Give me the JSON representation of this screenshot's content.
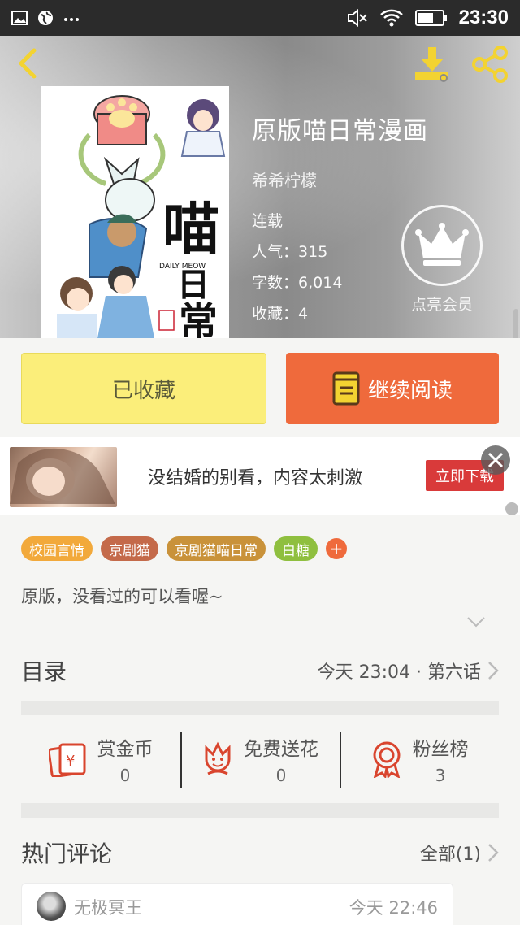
{
  "status_bar": {
    "time": "23:30",
    "icons": [
      "image-icon",
      "globe-icon",
      "more-dots-icon",
      "mute-icon",
      "wifi-icon",
      "battery-icon"
    ]
  },
  "header": {
    "back_icon": "back-chevron-icon",
    "download_icon": "download-icon",
    "share_icon": "share-icon"
  },
  "comic": {
    "title": "原版喵日常漫画",
    "author": "希希柠檬",
    "status": "连载",
    "popularity_label": "人气：",
    "popularity": "315",
    "word_count_label": "字数：",
    "word_count": "6,014",
    "favorites_label": "收藏：",
    "favorites": "4",
    "vip_label": "点亮会员",
    "cover_caption": "DAILY MEOW"
  },
  "actions": {
    "favorited_label": "已收藏",
    "continue_label": "继续阅读"
  },
  "ad": {
    "text": "没结婚的别看，内容太刺激",
    "button": "立即下载"
  },
  "tags": [
    {
      "label": "校园言情",
      "color": "#f2a93b"
    },
    {
      "label": "京剧猫",
      "color": "#c46a4a"
    },
    {
      "label": "京剧猫喵日常",
      "color": "#c9923a"
    },
    {
      "label": "白糖",
      "color": "#8fbf3f"
    }
  ],
  "tag_add": "+",
  "description": "原版，没看过的可以看喔~",
  "catalog": {
    "title": "目录",
    "latest": "今天 23:04 · 第六话"
  },
  "rewards": [
    {
      "label": "赏金币",
      "value": "0",
      "icon": "red-envelope-icon"
    },
    {
      "label": "免费送花",
      "value": "0",
      "icon": "flower-icon"
    },
    {
      "label": "粉丝榜",
      "value": "3",
      "icon": "medal-icon"
    }
  ],
  "comments": {
    "title": "热门评论",
    "all_label": "全部(1)",
    "items": [
      {
        "user": "无极冥王",
        "time": "今天 22:46"
      }
    ]
  },
  "colors": {
    "accent_orange": "#ef6a3c",
    "favorite_yellow": "#fbee7a",
    "icon_yellow": "#f3d331",
    "reward_red": "#d9452e"
  }
}
